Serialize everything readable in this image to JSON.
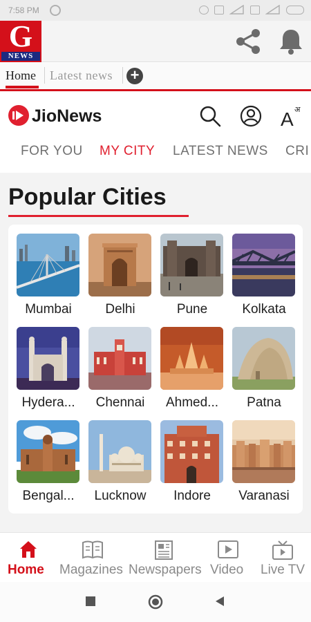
{
  "status_bar": {
    "time": "7:58 PM",
    "icons": [
      "notification-icon",
      "alarm-icon",
      "volte-icon",
      "signal-icon",
      "signal-icon",
      "battery-icon"
    ]
  },
  "gnews": {
    "logo_letter": "G",
    "logo_word": "NEWS",
    "brand_color": "#d4101a",
    "icons": [
      "share-icon",
      "bell-icon"
    ]
  },
  "browser_tabs": [
    {
      "label": "Home",
      "active": true
    },
    {
      "label": "Latest  news",
      "active": false
    }
  ],
  "jionews": {
    "title": "JioNews",
    "accent": "#e0202f",
    "tabs": [
      {
        "label": "FOR YOU",
        "active": false
      },
      {
        "label": "MY CITY",
        "active": true
      },
      {
        "label": "LATEST NEWS",
        "active": false
      },
      {
        "label": "CRI",
        "active": false
      }
    ],
    "font_icon_label": "A",
    "font_icon_sup": "अ"
  },
  "section": {
    "title": "Popular Cities",
    "cities": [
      {
        "name": "Mumbai"
      },
      {
        "name": "Delhi"
      },
      {
        "name": "Pune"
      },
      {
        "name": "Kolkata"
      },
      {
        "name": "Hydera..."
      },
      {
        "name": "Chennai"
      },
      {
        "name": "Ahmed..."
      },
      {
        "name": "Patna"
      },
      {
        "name": "Bengal..."
      },
      {
        "name": "Lucknow"
      },
      {
        "name": "Indore"
      },
      {
        "name": "Varanasi"
      }
    ]
  },
  "bottom_nav": [
    {
      "label": "Home",
      "icon": "home-icon",
      "active": true
    },
    {
      "label": "Magazines",
      "icon": "magazine-icon",
      "active": false
    },
    {
      "label": "Newspapers",
      "icon": "newspaper-icon",
      "active": false
    },
    {
      "label": "Video",
      "icon": "video-icon",
      "active": false
    },
    {
      "label": "Live TV",
      "icon": "tv-icon",
      "active": false
    }
  ],
  "system_nav": [
    "recents-button",
    "home-button",
    "back-button"
  ]
}
